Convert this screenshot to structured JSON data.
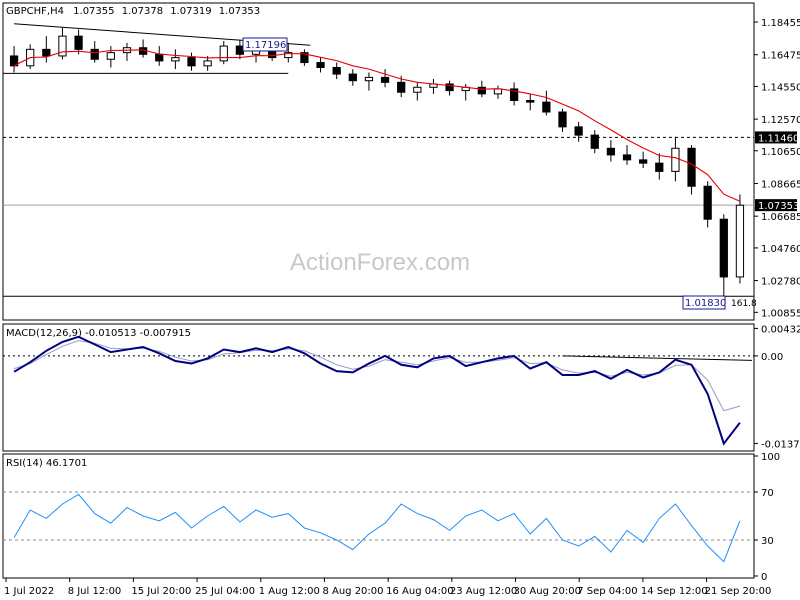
{
  "chart_data": {
    "type": "candlestick",
    "header": {
      "symbol": "GBPCHF,H4",
      "open": "1.07355",
      "high": "1.07378",
      "low": "1.07319",
      "close": "1.07353"
    },
    "watermark": "ActionForex.com",
    "x_ticks": [
      "1 Jul 2022",
      "8 Jul 12:00",
      "15 Jul 20:00",
      "25 Jul 04:00",
      "1 Aug 12:00",
      "8 Aug 20:00",
      "16 Aug 04:00",
      "23 Aug 12:00",
      "30 Aug 20:00",
      "7 Sep 04:00",
      "14 Sep 12:00",
      "21 Sep 20:00"
    ],
    "main": {
      "y_ticks": [
        "1.18455",
        "1.16475",
        "1.14550",
        "1.12570",
        "1.10650",
        "1.08665",
        "1.06685",
        "1.04760",
        "1.02780",
        "1.00855"
      ],
      "ylim": [
        1.0045,
        1.1955
      ],
      "price_labels": [
        "1.11460",
        "1.07353"
      ],
      "annotations": {
        "high_label": "1.17196",
        "low_label": "1.01830",
        "fib_label": "161.8"
      },
      "levels": {
        "resistance": 1.1146,
        "last": 1.07353,
        "low": 1.0183,
        "high": 1.17196
      },
      "channel": {
        "upper": [
          [
            "1 Jul 2022",
            1.1835
          ],
          [
            "5 Aug",
            1.1705
          ]
        ],
        "lower": [
          [
            "1 Jul 2022",
            1.1534
          ],
          [
            "5 Aug",
            1.1534
          ]
        ]
      },
      "ohlc": [
        [
          "1 Jul",
          1.164,
          1.17,
          1.154,
          1.158
        ],
        [
          "3 Jul",
          1.158,
          1.171,
          1.156,
          1.168
        ],
        [
          "5 Jul",
          1.168,
          1.176,
          1.16,
          1.164
        ],
        [
          "7 Jul",
          1.164,
          1.181,
          1.162,
          1.176
        ],
        [
          "9 Jul",
          1.176,
          1.18,
          1.165,
          1.168
        ],
        [
          "11 Jul",
          1.168,
          1.173,
          1.16,
          1.162
        ],
        [
          "13 Jul",
          1.162,
          1.17,
          1.157,
          1.166
        ],
        [
          "15 Jul",
          1.166,
          1.172,
          1.161,
          1.169
        ],
        [
          "17 Jul",
          1.169,
          1.174,
          1.163,
          1.165
        ],
        [
          "19 Jul",
          1.165,
          1.17,
          1.158,
          1.161
        ],
        [
          "21 Jul",
          1.161,
          1.168,
          1.156,
          1.163
        ],
        [
          "23 Jul",
          1.163,
          1.166,
          1.155,
          1.158
        ],
        [
          "25 Jul",
          1.158,
          1.164,
          1.155,
          1.161
        ],
        [
          "27 Jul",
          1.161,
          1.173,
          1.159,
          1.17
        ],
        [
          "29 Jul",
          1.17,
          1.174,
          1.162,
          1.165
        ],
        [
          "31 Jul",
          1.165,
          1.171,
          1.16,
          1.168
        ],
        [
          "2 Aug",
          1.168,
          1.172,
          1.161,
          1.163
        ],
        [
          "4 Aug",
          1.163,
          1.172,
          1.16,
          1.166
        ],
        [
          "6 Aug",
          1.166,
          1.168,
          1.158,
          1.16
        ],
        [
          "8 Aug",
          1.16,
          1.163,
          1.154,
          1.157
        ],
        [
          "10 Aug",
          1.157,
          1.16,
          1.15,
          1.153
        ],
        [
          "12 Aug",
          1.153,
          1.156,
          1.146,
          1.149
        ],
        [
          "14 Aug",
          1.149,
          1.154,
          1.143,
          1.151
        ],
        [
          "16 Aug",
          1.151,
          1.156,
          1.145,
          1.148
        ],
        [
          "18 Aug",
          1.148,
          1.152,
          1.139,
          1.142
        ],
        [
          "20 Aug",
          1.142,
          1.148,
          1.137,
          1.145
        ],
        [
          "22 Aug",
          1.145,
          1.15,
          1.141,
          1.147
        ],
        [
          "24 Aug",
          1.147,
          1.149,
          1.14,
          1.143
        ],
        [
          "26 Aug",
          1.143,
          1.147,
          1.137,
          1.145
        ],
        [
          "28 Aug",
          1.145,
          1.149,
          1.139,
          1.141
        ],
        [
          "30 Aug",
          1.141,
          1.146,
          1.138,
          1.144
        ],
        [
          "1 Sep",
          1.144,
          1.148,
          1.134,
          1.137
        ],
        [
          "3 Sep",
          1.137,
          1.141,
          1.131,
          1.136
        ],
        [
          "5 Sep",
          1.136,
          1.143,
          1.128,
          1.13
        ],
        [
          "7 Sep",
          1.13,
          1.132,
          1.118,
          1.121
        ],
        [
          "9 Sep",
          1.121,
          1.124,
          1.112,
          1.116
        ],
        [
          "11 Sep",
          1.116,
          1.119,
          1.105,
          1.108
        ],
        [
          "13 Sep",
          1.108,
          1.113,
          1.1,
          1.104
        ],
        [
          "15 Sep",
          1.104,
          1.11,
          1.098,
          1.101
        ],
        [
          "17 Sep",
          1.101,
          1.106,
          1.096,
          1.099
        ],
        [
          "19 Sep",
          1.099,
          1.105,
          1.089,
          1.094
        ],
        [
          "21 Sep",
          1.094,
          1.115,
          1.088,
          1.108
        ],
        [
          "22 Sep",
          1.108,
          1.11,
          1.08,
          1.085
        ],
        [
          "23 Sep",
          1.085,
          1.088,
          1.06,
          1.065
        ],
        [
          "25 Sep",
          1.065,
          1.068,
          1.018,
          1.03
        ],
        [
          "26 Sep",
          1.03,
          1.08,
          1.026,
          1.0735
        ]
      ]
    },
    "macd": {
      "label": "MACD(12,26,9) -0.010513 -0.007915",
      "y_ticks": [
        "0.004322",
        "0.00",
        "-0.013765"
      ],
      "ylim": [
        -0.0148,
        0.0047
      ],
      "resistance_line": [
        [
          "7 Sep",
          0.0
        ],
        [
          "26 Sep",
          -0.0007
        ]
      ],
      "values": [
        -0.0025,
        -0.001,
        0.0008,
        0.0022,
        0.003,
        0.0018,
        0.0006,
        0.001,
        0.0014,
        0.0004,
        -0.0008,
        -0.0012,
        -0.0004,
        0.001,
        0.0006,
        0.0012,
        0.0006,
        0.0014,
        0.0004,
        -0.0012,
        -0.0024,
        -0.0026,
        -0.0012,
        0.0,
        -0.0014,
        -0.0018,
        -0.0004,
        0.0,
        -0.0016,
        -0.001,
        -0.0004,
        0.0,
        -0.002,
        -0.001,
        -0.003,
        -0.003,
        -0.0024,
        -0.0036,
        -0.0022,
        -0.0034,
        -0.0026,
        -0.0006,
        -0.0014,
        -0.006,
        -0.0138,
        -0.0105
      ],
      "signal": [
        -0.002,
        -0.0012,
        0.0002,
        0.0015,
        0.0024,
        0.002,
        0.0012,
        0.0011,
        0.0012,
        0.0007,
        -0.0002,
        -0.0008,
        -0.0006,
        0.0003,
        0.0005,
        0.0009,
        0.0008,
        0.0011,
        0.0008,
        -0.0002,
        -0.0014,
        -0.0021,
        -0.0016,
        -0.0006,
        -0.001,
        -0.0014,
        -0.0008,
        -0.0003,
        -0.001,
        -0.001,
        -0.0007,
        -0.0003,
        -0.0012,
        -0.0011,
        -0.0022,
        -0.0027,
        -0.0026,
        -0.0032,
        -0.0026,
        -0.003,
        -0.0027,
        -0.0015,
        -0.0014,
        -0.0038,
        -0.0086,
        -0.0079
      ]
    },
    "rsi": {
      "label": "RSI(14) 46.1701",
      "y_ticks": [
        "100",
        "70",
        "30",
        "0"
      ],
      "ylim": [
        0,
        100
      ],
      "levels": [
        70,
        30
      ],
      "values": [
        32,
        55,
        48,
        60,
        68,
        52,
        44,
        57,
        50,
        46,
        53,
        40,
        50,
        58,
        45,
        55,
        49,
        52,
        40,
        36,
        30,
        22,
        35,
        44,
        60,
        52,
        47,
        38,
        50,
        55,
        46,
        52,
        35,
        48,
        30,
        25,
        33,
        20,
        38,
        28,
        48,
        60,
        42,
        25,
        12,
        46
      ]
    }
  }
}
